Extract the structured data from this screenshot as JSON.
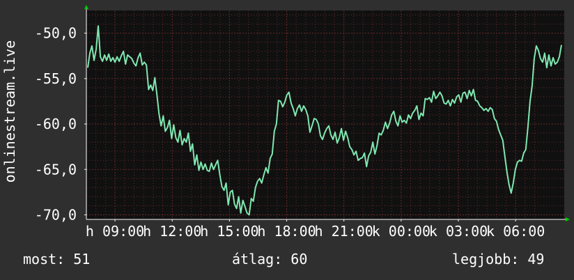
{
  "chart_data": {
    "type": "line",
    "ylabel": "onlinestream.live",
    "ylim": [
      -70.5,
      -47.5
    ],
    "yticks": [
      -50,
      -55,
      -60,
      -65,
      -70
    ],
    "ytick_labels": [
      "-50,0",
      "-55,0",
      "-60,0",
      "-65,0",
      "-70,0"
    ],
    "xtick_labels": [
      "h 09:00",
      "h 12:00",
      "h 15:00",
      "h 18:00",
      "h 21:00",
      "k 00:00",
      "k 03:00",
      "k 06:00"
    ],
    "grid": true,
    "colors": {
      "line": "#7fe8b0",
      "plot_bg": "#101010",
      "grid": "#6a2a2a",
      "axis": "#ffffff"
    },
    "series": [
      {
        "values": [
          -53.8,
          -52.2,
          -51.4,
          -53.0,
          -51.8,
          -49.2,
          -52.6,
          -53.1,
          -52.4,
          -53.0,
          -52.3,
          -53.1,
          -52.7,
          -53.2,
          -52.6,
          -53.1,
          -52.5,
          -52.0,
          -53.4,
          -52.4,
          -52.6,
          -52.8,
          -53.3,
          -53.6,
          -52.7,
          -52.2,
          -53.5,
          -53.2,
          -53.5,
          -56.2,
          -55.7,
          -56.3,
          -54.9,
          -56.8,
          -58.9,
          -60.2,
          -59.1,
          -60.8,
          -60.4,
          -59.6,
          -61.6,
          -60.1,
          -61.5,
          -62.0,
          -60.7,
          -62.3,
          -61.6,
          -62.0,
          -61.0,
          -63.0,
          -62.2,
          -64.5,
          -63.4,
          -65.1,
          -64.2,
          -65.0,
          -64.4,
          -65.1,
          -65.2,
          -64.3,
          -65.0,
          -64.5,
          -64.0,
          -65.6,
          -66.9,
          -67.3,
          -66.5,
          -68.9,
          -67.5,
          -67.3,
          -68.8,
          -69.3,
          -68.0,
          -69.8,
          -68.4,
          -69.1,
          -69.8,
          -70.0,
          -68.2,
          -68.5,
          -67.0,
          -66.3,
          -66.0,
          -66.5,
          -65.6,
          -64.8,
          -65.4,
          -63.8,
          -63.3,
          -60.8,
          -60.0,
          -57.4,
          -57.5,
          -58.1,
          -57.6,
          -56.8,
          -56.5,
          -57.7,
          -58.3,
          -59.1,
          -58.3,
          -57.9,
          -58.6,
          -58.0,
          -58.4,
          -59.1,
          -60.9,
          -60.2,
          -59.4,
          -59.5,
          -60.0,
          -61.3,
          -61.7,
          -61.0,
          -60.5,
          -60.2,
          -61.2,
          -61.7,
          -60.9,
          -62.1,
          -61.5,
          -60.5,
          -61.8,
          -60.8,
          -61.5,
          -62.5,
          -62.8,
          -63.4,
          -63.0,
          -64.0,
          -63.8,
          -63.7,
          -63.2,
          -64.7,
          -63.5,
          -63.1,
          -62.0,
          -63.3,
          -62.4,
          -61.0,
          -61.2,
          -60.7,
          -59.8,
          -60.5,
          -59.9,
          -59.0,
          -58.6,
          -59.7,
          -60.2,
          -59.1,
          -59.8,
          -59.6,
          -59.9,
          -59.0,
          -59.4,
          -58.8,
          -58.5,
          -58.0,
          -59.5,
          -58.8,
          -59.1,
          -57.2,
          -57.3,
          -57.1,
          -57.6,
          -56.4,
          -57.2,
          -56.9,
          -56.5,
          -56.9,
          -57.7,
          -57.8,
          -57.4,
          -58.0,
          -57.3,
          -57.7,
          -57.0,
          -56.8,
          -57.6,
          -56.6,
          -56.5,
          -57.2,
          -56.3,
          -56.9,
          -56.2,
          -57.4,
          -57.5,
          -58.0,
          -58.2,
          -58.5,
          -58.3,
          -58.6,
          -58.2,
          -58.4,
          -59.4,
          -59.7,
          -60.6,
          -61.2,
          -61.8,
          -63.6,
          -65.3,
          -66.7,
          -67.6,
          -66.5,
          -65.0,
          -64.2,
          -64.0,
          -64.1,
          -63.2,
          -62.8,
          -60.3,
          -57.5,
          -55.8,
          -52.8,
          -51.4,
          -51.9,
          -52.8,
          -53.2,
          -52.2,
          -53.8,
          -52.4,
          -53.6,
          -52.7,
          -53.4,
          -53.2,
          -52.6,
          -51.3
        ]
      }
    ]
  },
  "stats": {
    "now": "most: 51",
    "avg": "átlag: 60",
    "best": "legjobb: 49"
  }
}
